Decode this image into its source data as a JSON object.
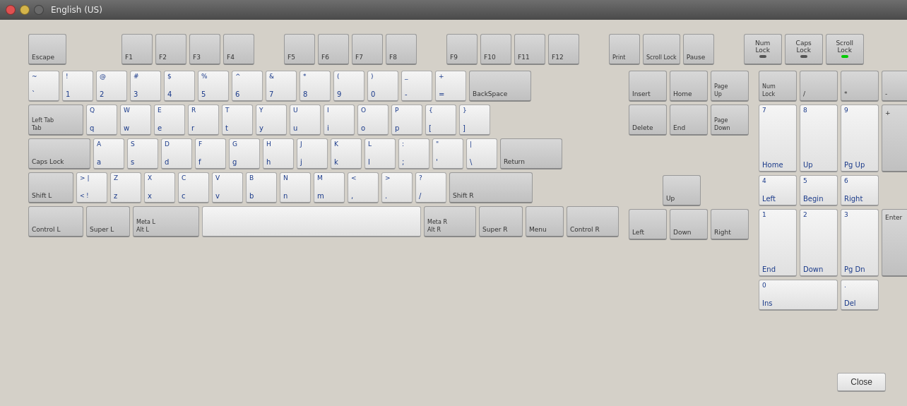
{
  "titlebar": {
    "title": "English (US)"
  },
  "keyboard": {
    "rows": {
      "fn": [
        "Escape",
        "",
        "F1",
        "F2",
        "F3",
        "F4",
        "",
        "F5",
        "F6",
        "F7",
        "F8",
        "",
        "F9",
        "F10",
        "F11",
        "F12"
      ],
      "number": [
        "~\n`",
        "!\n1",
        "@\n2",
        "#\n3",
        "$\n4",
        "%\n5",
        "^\n6",
        "&\n7",
        "*\n8",
        "(\n9",
        ")\n0",
        "_\n-",
        "+\n=",
        "BackSpace"
      ],
      "tab": [
        "Left Tab\nTab",
        "Q\nq",
        "W\nw",
        "E\ne",
        "R\nr",
        "T\nt",
        "Y\ny",
        "U\nu",
        "I\ni",
        "O\no",
        "P\np",
        "{\n[",
        "}\n]"
      ],
      "caps": [
        "Caps Lock",
        "A\na",
        "S\ns",
        "D\nd",
        "F\nf",
        "G\ng",
        "H\nh",
        "J\nj",
        "K\nk",
        "L\nl",
        ":\n;",
        "\"\n'",
        "|\n\\",
        "Return"
      ],
      "shift": [
        "Shift L",
        ">  <\n|  !",
        "Z\nz",
        "X\nx",
        "C\nc",
        "V\nv",
        "B\nb",
        "N\nn",
        "M\nm",
        "<\n,",
        ">\n.",
        "?\n/",
        "Shift R"
      ],
      "ctrl": [
        "Control L",
        "Super L",
        "Meta L\nAlt L",
        "",
        "Meta R\nAlt R",
        "Super R",
        "Menu",
        "Control R"
      ]
    }
  },
  "close_button": "Close"
}
